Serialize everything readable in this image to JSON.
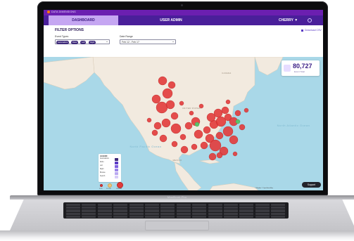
{
  "app": {
    "brand": "DATA DIMENSIONS",
    "tabs": [
      {
        "label": "DASHBOARD",
        "active": true
      },
      {
        "label": "USER ADMIN",
        "active": false
      }
    ],
    "user_menu": "CHERRY ▼"
  },
  "filters": {
    "title": "FILTER OPTIONS",
    "download_label": "Download CSV",
    "event_types_label": "Event Types",
    "event_chips": [
      "Automations",
      "Robo",
      "Left",
      "Right"
    ],
    "date_range_label": "Date Range",
    "date_range_value": "Feb 12 - Feb 17"
  },
  "total": {
    "value": "80,727",
    "label": "Event Total"
  },
  "map_labels": {
    "north_pacific": "North\nPacific\nOcean",
    "north_atlantic": "North\nAtlantic\nOcean",
    "united_states": "UNITED STATES",
    "canada": "CANADA",
    "mexico": "MEXICO"
  },
  "legend": {
    "title": "LEGEND",
    "items": [
      {
        "label": "Automations",
        "color": "#3e2a7a"
      },
      {
        "label": "Robo",
        "color": "#5a3bc5"
      },
      {
        "label": "Left",
        "color": "#7e5ee0"
      },
      {
        "label": "Right",
        "color": "#9b84ea"
      },
      {
        "label": "Browse",
        "color": "#b9a8f1"
      },
      {
        "label": "Search",
        "color": "#d7ccf8"
      }
    ]
  },
  "size_legend": [
    "0-10",
    "11-100",
    "100-500"
  ],
  "support_label": "Support",
  "attribution": "© Mapbox © OpenStreetMap",
  "device_label": "MacBook Pro",
  "colors": {
    "purple_dark": "#4a1f9a",
    "purple_accent": "#c5a6f2",
    "cluster_red": "#e23b3b",
    "cluster_green": "#5bc26a",
    "water": "#a9d8e8",
    "land": "#f2eadf"
  }
}
